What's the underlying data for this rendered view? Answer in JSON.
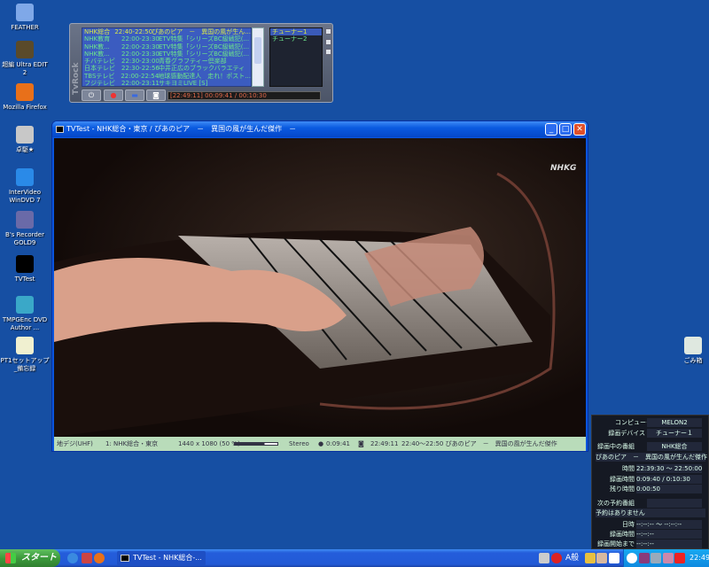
{
  "desktop": {
    "icons": [
      {
        "label": "FEATHER",
        "color": "#7fa8e8"
      },
      {
        "label": "超編 Ultra EDIT 2",
        "color": "#5a4a2a"
      },
      {
        "label": "Mozilla Firefox",
        "color": "#e8701a"
      },
      {
        "label": "卓駆★",
        "color": "#c8c8c8"
      },
      {
        "label": "InterVideo WinDVD 7",
        "color": "#2a8ae8"
      },
      {
        "label": "B's Recorder GOLD9",
        "color": "#6a6aa8"
      },
      {
        "label": "TVTest",
        "color": "#000000"
      },
      {
        "label": "TMPGEnc DVD Author ...",
        "color": "#3aa8c8"
      },
      {
        "label": "PT1セットアップ_備忘録",
        "color": "#f0f0d0"
      }
    ],
    "recycle_bin": "ごみ箱"
  },
  "tvrock": {
    "logo": "TvRock",
    "programs": [
      [
        "NHK総合",
        "22:40-22:50",
        "ぴあのピア　－　異国の風が生ん..."
      ],
      [
        "NHK教育",
        "22:00-23:30",
        "ETV特集「シリーズBC級戦犯(..."
      ],
      [
        "NHK教...",
        "22:00-23:30",
        "ETV特集「シリーズBC級戦犯(..."
      ],
      [
        "NHK教...",
        "22:00-23:30",
        "ETV特集「シリーズBC級戦犯(..."
      ],
      [
        "チバテレビ",
        "22:30-23:00",
        "青春グラフティー倶楽部"
      ],
      [
        "日本テレビ",
        "22:30-22:56",
        "中井正広のブラックバラエティ"
      ],
      [
        "TBSテレビ",
        "22:00-22:54",
        "地球感動配達人　走れ！ポスト..."
      ],
      [
        "フジテレビ",
        "22:00-23:11",
        "サキヨミLIVE [S]"
      ]
    ],
    "tuners": [
      "チューナー1",
      "チューナー2"
    ],
    "record_time": "[22:49:11] 00:09:41 / 00:10:30"
  },
  "tvtest": {
    "title": "TVTest - NHK総合・東京 / ぴあのピア　－　異国の風が生んだ傑作　－",
    "watermark": "NHKG",
    "status": {
      "network": "地デジ(UHF)",
      "channel": "1: NHK総合・東京",
      "video": "1440 x 1080 (50 %)",
      "audio": "Stereo",
      "rec_time": "0:09:41",
      "clock": "22:49:11",
      "program": "22:40～22:50 ぴあのピア　－　異国の風が生んだ傑作"
    }
  },
  "info_panel": {
    "computer_label": "コンピュータ",
    "computer": "MELON2",
    "device_label": "録画デバイス",
    "device": "チューナー１",
    "current_label": "録画中の番組",
    "current_channel": "NHK総合",
    "current_title": "ぴあのピア　－　異国の風が生んだ傑作",
    "time_label": "時間",
    "time": "22:39:30 ～ 22:50:00",
    "rec_label": "録画時間",
    "rec": "0:09:40 / 0:10:30",
    "remain_label": "残り時間",
    "remain": "0:00:50",
    "next_label": "次の予約番組",
    "next": "予約はありません",
    "date_label": "日時",
    "date": "--:--:-- ～ --:--:--",
    "next_rec_label": "録画時間",
    "next_rec": "--:--:--",
    "until_label": "録画開始まで",
    "until": "--:--:--"
  },
  "taskbar": {
    "start": "スタート",
    "task": "TVTest - NHK総合-...",
    "ime": "A般",
    "clock": "22:49"
  }
}
